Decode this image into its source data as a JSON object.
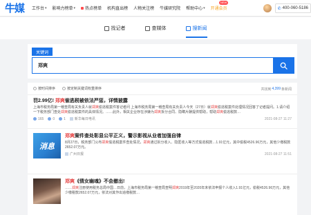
{
  "nav": {
    "logo": "牛媒",
    "items": [
      {
        "label": "工作台",
        "has_chevron": true,
        "hot": false
      },
      {
        "label": "影响力榜单",
        "has_chevron": true,
        "hot": false
      },
      {
        "label": "热点榜单",
        "has_chevron": false,
        "hot": true
      },
      {
        "label": "机构直出榜",
        "has_chevron": false,
        "hot": false
      },
      {
        "label": "人物关注榜",
        "has_chevron": false,
        "hot": false
      },
      {
        "label": "牛媒研究院",
        "has_chevron": false,
        "hot": false
      },
      {
        "label": "帮助中心",
        "has_chevron": true,
        "hot": false
      },
      {
        "label": "开通会员",
        "has_chevron": false,
        "hot": false
      }
    ],
    "badge": "NEW",
    "username": "",
    "phone": "400-060-5186"
  },
  "tabs": [
    {
      "label": "找记者",
      "active": false
    },
    {
      "label": "查媒体",
      "active": false
    },
    {
      "label": "搜新闻",
      "active": true
    }
  ],
  "search": {
    "tag": "关键词",
    "value": "郑爽"
  },
  "sort": {
    "options": [
      {
        "label": "按时间排序",
        "selected": false
      },
      {
        "label": "按定制关键词权重排序",
        "selected": false
      }
    ],
    "count_prefix": "共找到",
    "count": "4,399",
    "count_suffix": "条新闻"
  },
  "results": [
    {
      "title_pre": "罚2.99亿! ",
      "title_kw": "郑爽",
      "title_post": "偷逃税被依法严惩，详情披露",
      "summary_parts": [
        {
          "t": "上海市税务局第一稽查局有关负责人就",
          "kw": false
        },
        {
          "t": "郑爽",
          "kw": true
        },
        {
          "t": "偷逃税案件答记者问 上海市税务局第一稽查局有关负责人今天（27日）就",
          "kw": false
        },
        {
          "t": "郑爽",
          "kw": true
        },
        {
          "t": "偷逃税案件处理情况回答了记者提问。1.请介绍一下税务部门查处",
          "kw": false
        },
        {
          "t": "郑爽",
          "kw": true
        },
        {
          "t": "偷逃税案件的具体情况。……此外，相关企业存在涉嫌为",
          "kw": false
        },
        {
          "t": "郑爽",
          "kw": true
        },
        {
          "t": "拆分合同、隐瞒片酬提供帮助，帮助",
          "kw": false
        },
        {
          "t": "郑爽",
          "kw": true
        },
        {
          "t": "偷逃税款…",
          "kw": false
        }
      ],
      "stats": [
        "165",
        "0",
        "1"
      ],
      "source": "新华每日电讯",
      "time": "2021-08-27 11:27",
      "thumb": null
    },
    {
      "title_pre": "",
      "title_kw": "郑爽",
      "title_post": "案件查处彰显公平正义，警示影视从业者加强自律",
      "summary_parts": [
        {
          "t": "8月27日，税务部门公布",
          "kw": false
        },
        {
          "t": "郑爽",
          "kw": true
        },
        {
          "t": "偷逃税案件查处情况，",
          "kw": false
        },
        {
          "t": "郑爽",
          "kw": true
        },
        {
          "t": "通过拆分收入、隐匿收入等方式偷逃税款…1.91亿元，其中偷税4526.96万元，其他少缴税款2652.07万元。",
          "kw": false
        }
      ],
      "stats": [],
      "source": "广州日报",
      "time": "2021-08-27 11:51",
      "thumb": "消息"
    },
    {
      "title_pre": "",
      "title_kw": "郑爽",
      "title_post": "《倩女幽魂》不会撤出!",
      "summary_parts": [
        {
          "t": "……",
          "kw": false
        },
        {
          "t": "郑爽",
          "kw": true
        },
        {
          "t": "注册使用税务总局中国…日前，上海市税务局第一稽查局查明",
          "kw": false
        },
        {
          "t": "郑爽",
          "kw": true
        },
        {
          "t": "2019年至2020年未依法申报个人收入1.91亿元，偷税4526.96万元，其他少缴税款2652.07万元，依法对其作出追缴税款…",
          "kw": false
        }
      ],
      "stats": [],
      "source": "",
      "time": "",
      "thumb": "photo"
    }
  ]
}
